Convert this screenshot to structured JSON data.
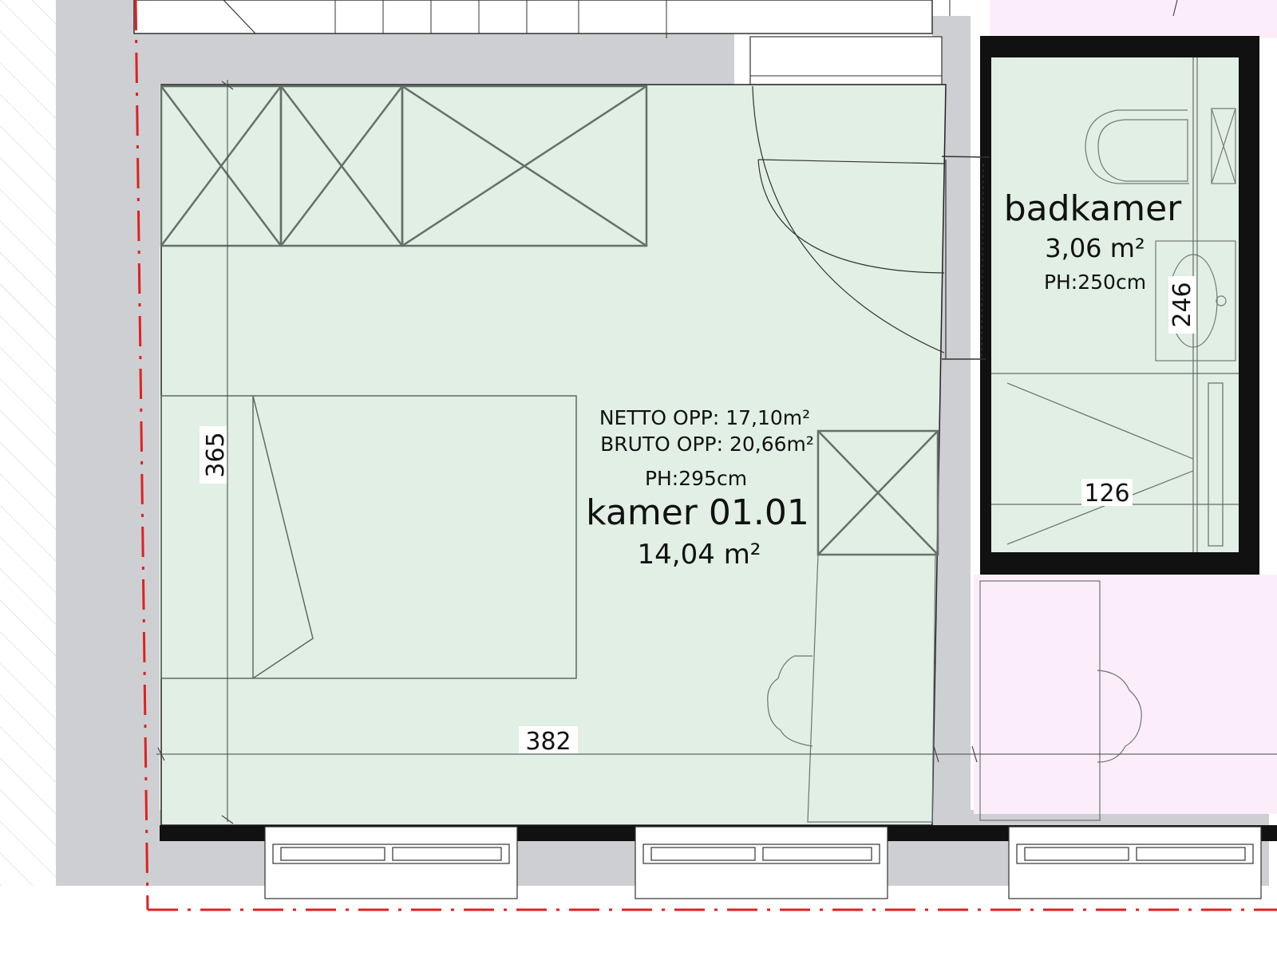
{
  "colors": {
    "room_main": "#e1efe4",
    "room_bath": "#e1efe4",
    "room_pink": "#fbeefa",
    "wall_grey": "#cdcfd2",
    "wall_dark": "#111111",
    "line": "#5f6a63",
    "axis_red": "#e02020",
    "hatch": "#d9d9d9"
  },
  "room_main": {
    "netto": "NETTO OPP: 17,10m²",
    "bruto": "BRUTO OPP: 20,66m²",
    "height": "PH:295cm",
    "name": "kamer 01.01",
    "area": "14,04 m²"
  },
  "room_bath": {
    "name": "badkamer",
    "area": "3,06 m²",
    "height": "PH:250cm"
  },
  "dimensions": {
    "depth_main": "365",
    "width_main": "382",
    "depth_bath": "246",
    "width_shower": "126"
  },
  "icons": {
    "wardrobe": "wardrobe-cross-icon",
    "bed": "double-bed-icon",
    "door": "door-swing-icon",
    "toilet": "toilet-icon",
    "sink": "sink-icon",
    "shower": "shower-icon",
    "chair": "chair-icon",
    "window": "window-icon"
  }
}
